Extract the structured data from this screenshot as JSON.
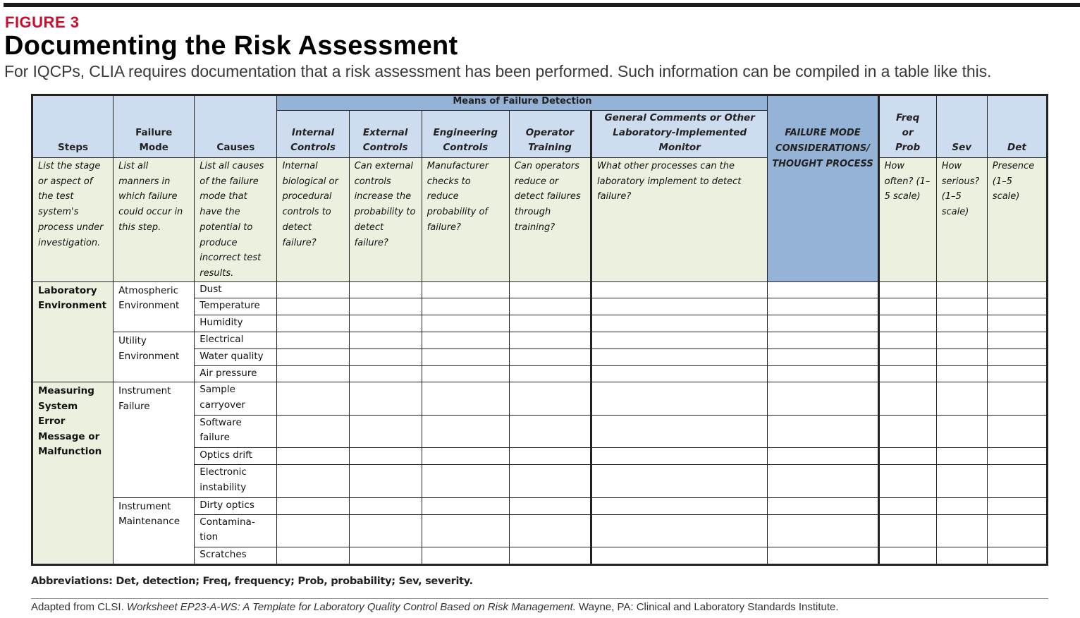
{
  "figure": {
    "label": "FIGURE 3",
    "title": "Documenting the Risk Assessment",
    "subtitle": "For IQCPs, CLIA requires documentation that a risk assessment has been performed. Such information can be compiled in a table like this."
  },
  "colors": {
    "figure_label": "#c8102e",
    "header_dark_blue": "#95b3d7",
    "header_light_blue": "#cddcee",
    "description_green": "#ebf1de"
  },
  "table": {
    "group_header": "Means of Failure Detection",
    "columns": [
      {
        "label": "Steps",
        "description": "List the stage or aspect of the test system's process under investigation."
      },
      {
        "label": "Failure Mode",
        "description": "List all manners in which failure could occur in this step."
      },
      {
        "label": "Causes",
        "description": "List all causes of the failure mode that have the potential to produce incorrect test results."
      },
      {
        "label": "Internal Controls",
        "description": "Internal biological or procedural controls to detect failure?"
      },
      {
        "label": "External Controls",
        "description": "Can external controls increase the probability to detect failure?"
      },
      {
        "label": "Engineering Controls",
        "description": "Manufacturer checks to reduce probability of failure?"
      },
      {
        "label": "Operator Training",
        "description": "Can operators reduce or detect failures through training?"
      },
      {
        "label": "General Comments or Other Laboratory-Implemented Monitor",
        "description": "What other processes can the laboratory implement to detect failure?"
      },
      {
        "label": "FAILURE MODE CONSIDERATIONS/ THOUGHT PROCESS",
        "description": ""
      },
      {
        "label": "Freq or Prob",
        "description": "How often? (1–5 scale)"
      },
      {
        "label": "Sev",
        "description": "How serious? (1–5 scale)"
      },
      {
        "label": "Det",
        "description": "Presence (1–5 scale)"
      }
    ],
    "steps": [
      {
        "step": "Laboratory Environment",
        "modes": [
          {
            "mode": "Atmospheric Environment",
            "causes": [
              "Dust",
              "Temperature",
              "Humidity"
            ]
          },
          {
            "mode": "Utility Environment",
            "causes": [
              "Electrical",
              "Water quality",
              "Air pressure"
            ]
          }
        ]
      },
      {
        "step": "Measuring System Error Message or Malfunction",
        "modes": [
          {
            "mode": "Instrument Failure",
            "causes": [
              "Sample carryover",
              "Software failure",
              "Optics drift",
              "Electronic instability"
            ]
          },
          {
            "mode": "Instrument Maintenance",
            "causes": [
              "Dirty optics",
              "Contamina-tion",
              "Scratches"
            ]
          }
        ]
      }
    ]
  },
  "footer": {
    "abbreviations": "Abbreviations: Det, detection; Freq, frequency; Prob, probability; Sev, severity.",
    "source_prefix": "Adapted from CLSI. ",
    "source_title": "Worksheet EP23-A-WS: A Template for Laboratory Quality Control Based on Risk Management.",
    "source_suffix": " Wayne, PA: Clinical and Laboratory Standards Institute."
  }
}
